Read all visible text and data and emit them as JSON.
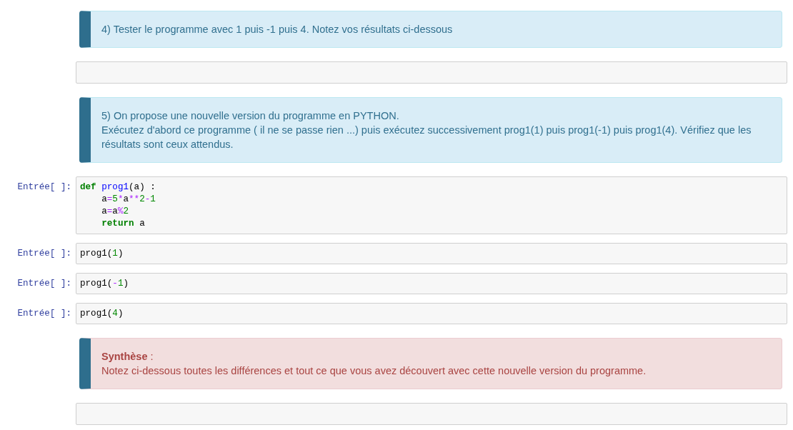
{
  "cells": [
    {
      "kind": "info",
      "lines": [
        "4) Tester le programme avec 1 puis -1 puis 4. Notez vos résultats ci-dessous"
      ]
    },
    {
      "kind": "answer"
    },
    {
      "kind": "info",
      "lines": [
        "5) On propose une nouvelle version du programme en PYTHON.",
        "Exécutez d'abord ce programme ( il ne se passe rien ...) puis exécutez successivement prog1(1) puis prog1(-1) puis prog1(4). Vérifiez que les résultats sont ceux attendus."
      ]
    },
    {
      "kind": "code",
      "prompt": "Entrée[ ]:",
      "code": [
        [
          {
            "kind": "keyword",
            "text": "def"
          },
          {
            "kind": "defname",
            "text": " prog1"
          },
          {
            "kind": "plain",
            "text": "(a) :"
          }
        ],
        [
          {
            "kind": "plain",
            "text": "    a"
          },
          {
            "kind": "operator",
            "text": "="
          },
          {
            "kind": "number",
            "text": "5"
          },
          {
            "kind": "operator",
            "text": "*"
          },
          {
            "kind": "plain",
            "text": "a"
          },
          {
            "kind": "operator",
            "text": "**"
          },
          {
            "kind": "number",
            "text": "2"
          },
          {
            "kind": "operator",
            "text": "-"
          },
          {
            "kind": "number",
            "text": "1"
          }
        ],
        [
          {
            "kind": "plain",
            "text": "    a"
          },
          {
            "kind": "operator",
            "text": "="
          },
          {
            "kind": "plain",
            "text": "a"
          },
          {
            "kind": "operator",
            "text": "%"
          },
          {
            "kind": "number",
            "text": "2"
          }
        ],
        [
          {
            "kind": "keyword",
            "text": "    return"
          },
          {
            "kind": "plain",
            "text": " a"
          }
        ]
      ]
    },
    {
      "kind": "code",
      "prompt": "Entrée[ ]:",
      "code": [
        [
          {
            "kind": "plain",
            "text": "prog1("
          },
          {
            "kind": "number",
            "text": "1"
          },
          {
            "kind": "plain",
            "text": ")"
          }
        ]
      ]
    },
    {
      "kind": "code",
      "prompt": "Entrée[ ]:",
      "code": [
        [
          {
            "kind": "plain",
            "text": "prog1("
          },
          {
            "kind": "operator",
            "text": "-"
          },
          {
            "kind": "number",
            "text": "1"
          },
          {
            "kind": "plain",
            "text": ")"
          }
        ]
      ]
    },
    {
      "kind": "code",
      "prompt": "Entrée[ ]:",
      "code": [
        [
          {
            "kind": "plain",
            "text": "prog1("
          },
          {
            "kind": "number",
            "text": "4"
          },
          {
            "kind": "plain",
            "text": ")"
          }
        ]
      ]
    },
    {
      "kind": "danger",
      "lines": [
        "**Synthèse** :",
        "Notez ci-dessous toutes les différences et tout ce que vous avez découvert avec cette nouvelle version du programme."
      ]
    },
    {
      "kind": "answer"
    }
  ]
}
